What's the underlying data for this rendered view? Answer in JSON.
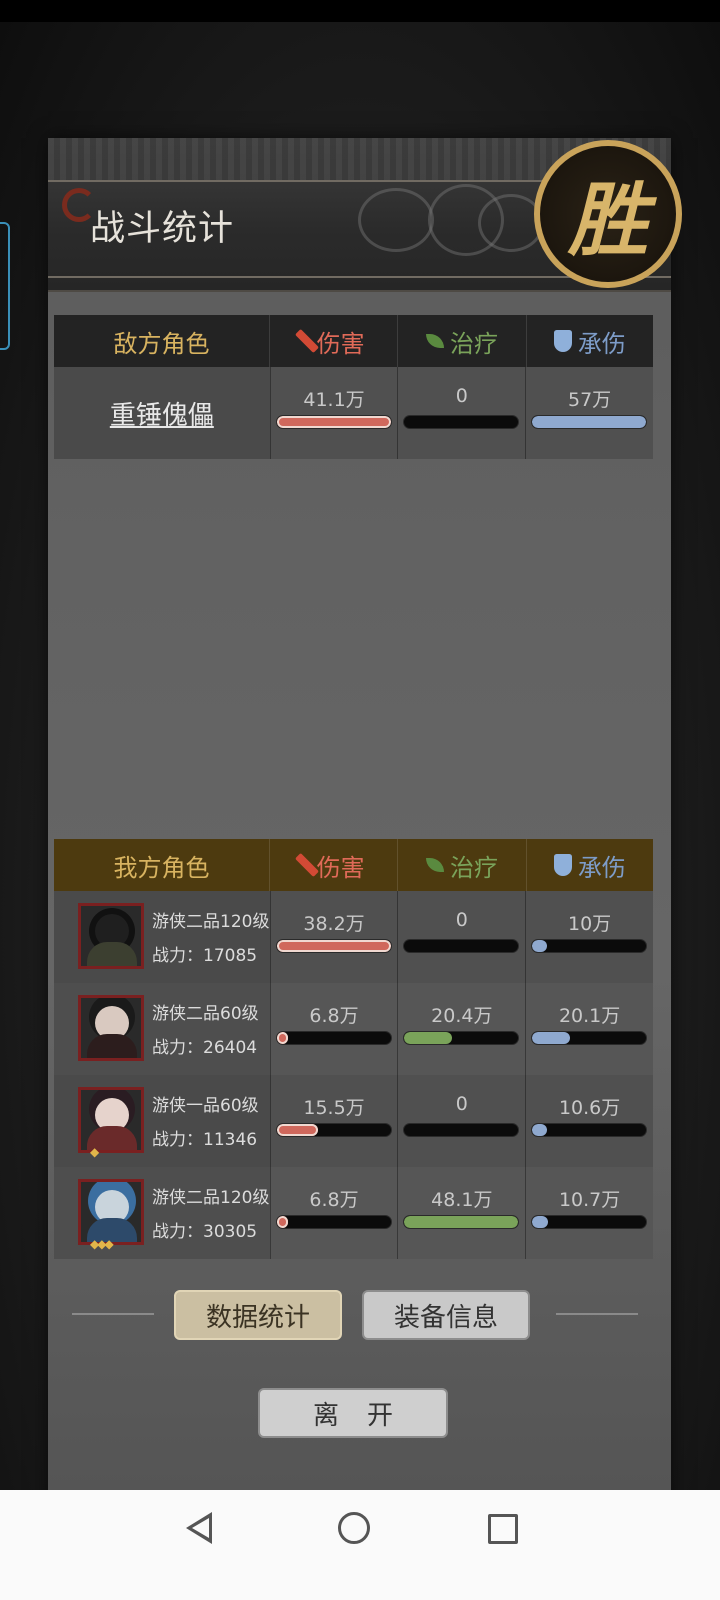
{
  "header": {
    "title": "战斗统计",
    "victory_seal": "胜"
  },
  "enemy_table": {
    "columns": {
      "role": "敌方角色",
      "damage": "伤害",
      "healing": "治疗",
      "tanked": "承伤"
    },
    "rows": [
      {
        "name": "重锤傀儡",
        "damage": "41.1万",
        "damage_pct": 100,
        "healing": "0",
        "healing_pct": 0,
        "tanked": "57万",
        "tanked_pct": 100
      }
    ]
  },
  "ally_table": {
    "columns": {
      "role": "我方角色",
      "damage": "伤害",
      "healing": "治疗",
      "tanked": "承伤"
    },
    "rows": [
      {
        "rank": "游侠二品120级",
        "power": "战力：17085",
        "stars": "",
        "damage": "38.2万",
        "damage_pct": 100,
        "healing": "0",
        "healing_pct": 0,
        "tanked": "10万",
        "tanked_pct": 13
      },
      {
        "rank": "游侠二品60级",
        "power": "战力：26404",
        "stars": "",
        "damage": "6.8万",
        "damage_pct": 10,
        "healing": "20.4万",
        "healing_pct": 42,
        "tanked": "20.1万",
        "tanked_pct": 33
      },
      {
        "rank": "游侠一品60级",
        "power": "战力：11346",
        "stars": "◆",
        "damage": "15.5万",
        "damage_pct": 36,
        "healing": "0",
        "healing_pct": 0,
        "tanked": "10.6万",
        "tanked_pct": 13
      },
      {
        "rank": "游侠二品120级",
        "power": "战力：30305",
        "stars": "◆◆◆",
        "damage": "6.8万",
        "damage_pct": 10,
        "healing": "48.1万",
        "healing_pct": 100,
        "tanked": "10.7万",
        "tanked_pct": 14
      }
    ]
  },
  "buttons": {
    "stats": "数据统计",
    "gear": "装备信息",
    "leave": "离开"
  },
  "colors": {
    "damage": "#d0685c",
    "healing": "#7aa35a",
    "tanked": "#8fa9cf",
    "gold": "#d8b360"
  }
}
